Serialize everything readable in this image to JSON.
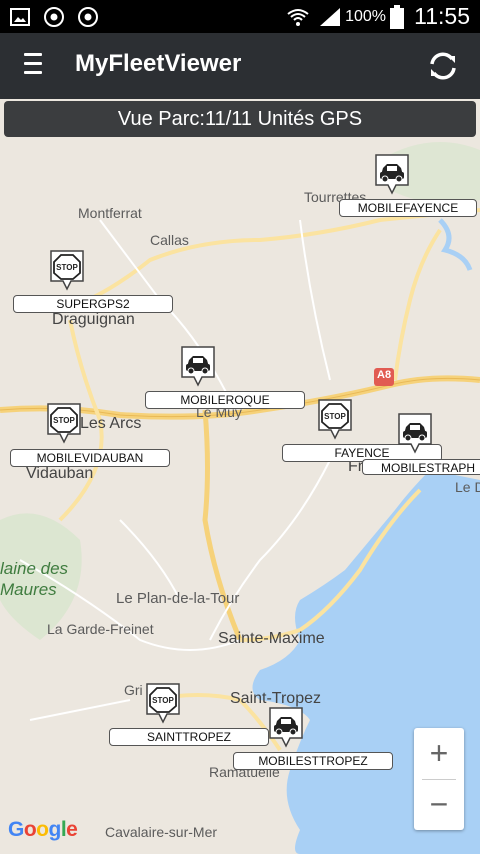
{
  "status_bar": {
    "battery_percent": "100%",
    "time": "11:55",
    "icons": [
      "image-icon",
      "chrome-icon",
      "chrome-icon",
      "wifi-icon",
      "signal-icon",
      "battery-icon"
    ]
  },
  "app_bar": {
    "title": "MyFleetViewer",
    "menu_icon": "hamburger-icon",
    "refresh_icon": "refresh-icon"
  },
  "banner": {
    "text": "Vue Parc:11/11 Unités GPS"
  },
  "places": {
    "montferrat": "Montferrat",
    "callas": "Callas",
    "tourrettes": "Tourrettes",
    "draguignan": "Draguignan",
    "le_muy": "Le Muy",
    "les_arcs": "Les Arcs",
    "vidauban": "Vidauban",
    "plaine_des_maures_1": "laine des",
    "plaine_des_maures_2": "Maures",
    "le_plan_de_la_tour": "Le Plan-de-la-Tour",
    "la_garde_freinet": "La Garde-Freinet",
    "sainte_maxime": "Sainte-Maxime",
    "grimaud": "Gri",
    "saint_tropez": "Saint-Tropez",
    "ramatuelle": "Ramatuelle",
    "cavalaire": "Cavalaire-sur-Mer",
    "frejus": "Fr",
    "le_d": "Le D",
    "a8": "A8"
  },
  "vehicles": [
    {
      "name": "MOBILEFAYENCE",
      "icon": "car-icon"
    },
    {
      "name": "SUPERGPS2",
      "icon": "stop-icon"
    },
    {
      "name": "MOBILEROQUE",
      "icon": "car-icon"
    },
    {
      "name": "MOBILEVIDAUBAN",
      "icon": "stop-icon"
    },
    {
      "name": "FAYENCE",
      "icon": "stop-icon"
    },
    {
      "name": "MOBILESTRAPH",
      "icon": "car-icon"
    },
    {
      "name": "SAINTTROPEZ",
      "icon": "stop-icon"
    },
    {
      "name": "MOBILESTTROPEZ",
      "icon": "car-icon"
    }
  ],
  "zoom": {
    "in": "+",
    "out": "−"
  },
  "attribution": {
    "letters": [
      "G",
      "o",
      "o",
      "g",
      "l",
      "e"
    ],
    "colors": [
      "#4285F4",
      "#EA4335",
      "#FBBC05",
      "#4285F4",
      "#34A853",
      "#EA4335"
    ]
  },
  "colors": {
    "sea": "#a9d0f5",
    "land": "#ece7df",
    "appbar": "#2c2f33",
    "major_road": "#f6d27a"
  }
}
